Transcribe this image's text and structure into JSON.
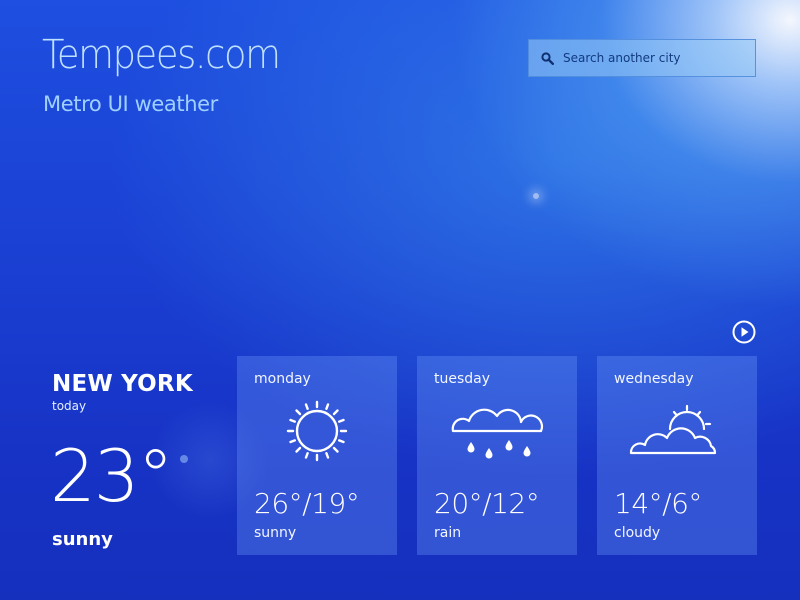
{
  "header": {
    "title": "Tempees.com",
    "subtitle": "Metro UI weather"
  },
  "search": {
    "placeholder": "Search another city",
    "icon": "search-icon"
  },
  "navigation": {
    "next_icon": "play-circle-icon"
  },
  "current": {
    "city": "NEW YORK",
    "day": "today",
    "temperature": "23°",
    "condition": "sunny"
  },
  "forecast": [
    {
      "day": "monday",
      "icon": "sun-icon",
      "temperature": "26°/19°",
      "condition": "sunny"
    },
    {
      "day": "tuesday",
      "icon": "rain-cloud-icon",
      "temperature": "20°/12°",
      "condition": "rain"
    },
    {
      "day": "wednesday",
      "icon": "cloudy-icon",
      "temperature": "14°/6°",
      "condition": "cloudy"
    }
  ],
  "colors": {
    "background": "#1a3fd2",
    "title": "#bfe0ff",
    "search_background": "#96c8f5",
    "card_background": "#78a5ff"
  }
}
